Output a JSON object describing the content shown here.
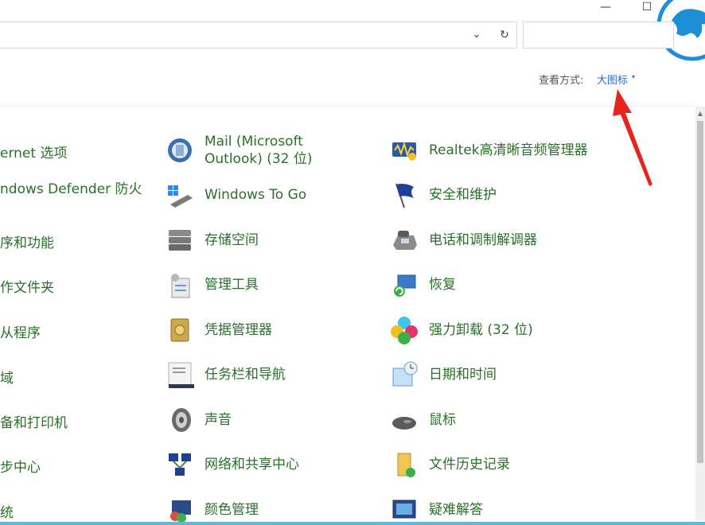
{
  "window": {
    "minimize_glyph": "—",
    "maximize_glyph": "☐"
  },
  "address_bar": {
    "dropdown_glyph": "⌄",
    "refresh_glyph": "↻"
  },
  "view": {
    "label": "查看方式:",
    "value": "大图标",
    "arrow_glyph": "▾"
  },
  "left_column_clipped": [
    "ernet 选项",
    "ndows Defender 防火",
    "序和功能",
    "作文件夹",
    "从程序",
    "域",
    "备和打印机",
    "步中心",
    "统"
  ],
  "middle_column": [
    {
      "label1": "Mail (Microsoft",
      "label2": "Outlook) (32 位)",
      "icon": "mail-icon"
    },
    {
      "label": "Windows To Go",
      "icon": "windows-to-go-icon"
    },
    {
      "label": "存储空间",
      "icon": "storage-icon"
    },
    {
      "label": "管理工具",
      "icon": "admin-tools-icon"
    },
    {
      "label": "凭据管理器",
      "icon": "credential-icon"
    },
    {
      "label": "任务栏和导航",
      "icon": "taskbar-icon"
    },
    {
      "label": "声音",
      "icon": "speaker-icon"
    },
    {
      "label": "网络和共享中心",
      "icon": "network-icon"
    },
    {
      "label": "颜色管理",
      "icon": "color-icon"
    }
  ],
  "right_column": [
    {
      "label": "Realtek高清晰音频管理器",
      "icon": "realtek-audio-icon"
    },
    {
      "label": "安全和维护",
      "icon": "flag-icon"
    },
    {
      "label": "电话和调制解调器",
      "icon": "phone-icon"
    },
    {
      "label": "恢复",
      "icon": "recovery-icon"
    },
    {
      "label": "强力卸载 (32 位)",
      "icon": "uninstall-icon"
    },
    {
      "label": "日期和时间",
      "icon": "datetime-icon"
    },
    {
      "label": "鼠标",
      "icon": "mouse-icon"
    },
    {
      "label": "文件历史记录",
      "icon": "file-history-icon"
    },
    {
      "label": "疑难解答",
      "icon": "troubleshoot-icon"
    }
  ],
  "colors": {
    "item_text": "#2a6f2a",
    "link_blue": "#2a6fd0",
    "annotation_red": "#e8251d",
    "logo_blue": "#1d8fd6"
  }
}
